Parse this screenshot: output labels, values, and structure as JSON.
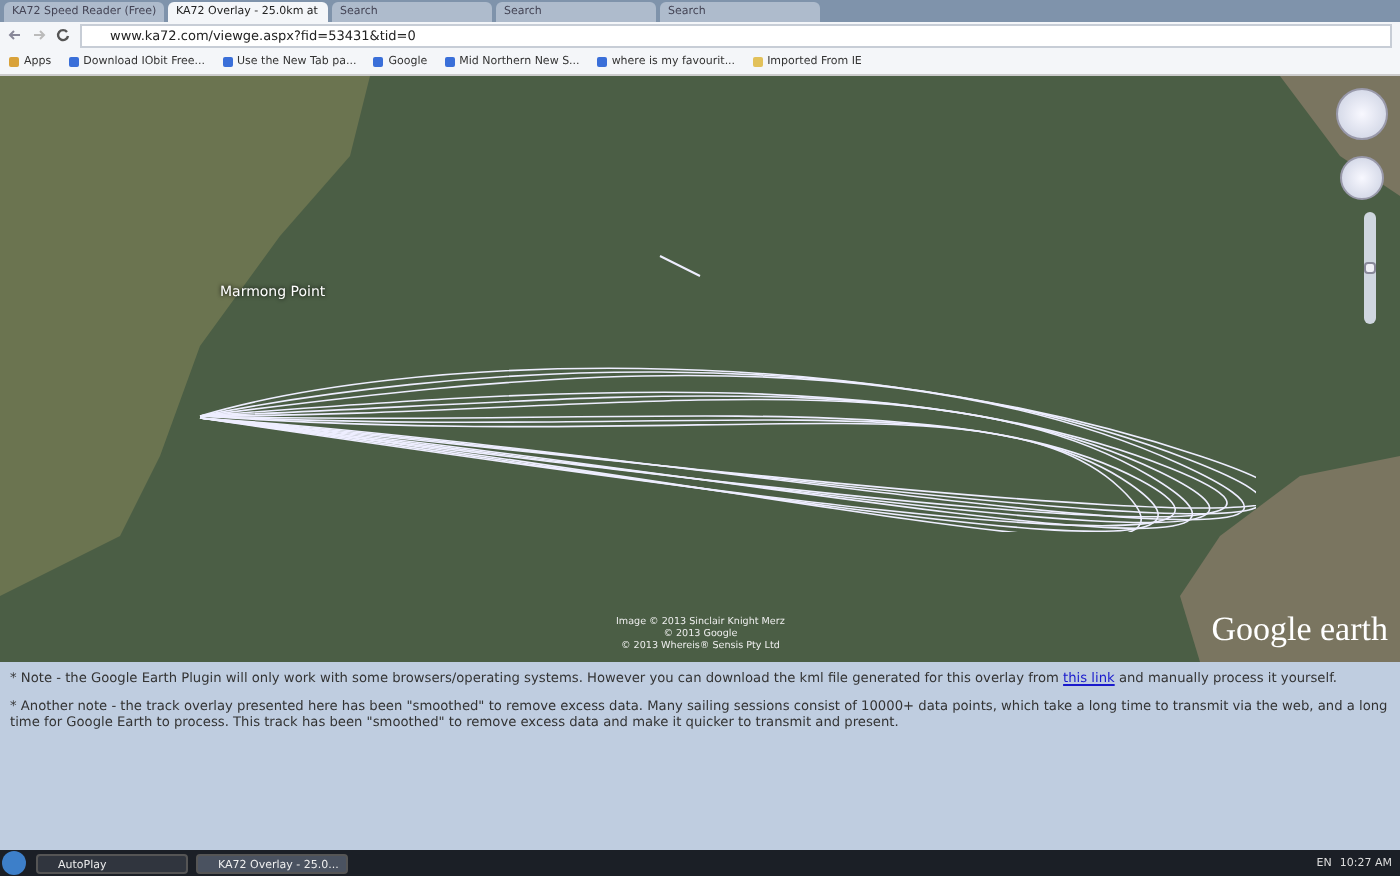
{
  "tabs": [
    {
      "label": "KA72 Speed Reader (Free)",
      "selected": false
    },
    {
      "label": "KA72 Overlay - 25.0km at",
      "selected": true
    },
    {
      "label": "Search",
      "selected": false
    },
    {
      "label": "Search",
      "selected": false
    },
    {
      "label": "Search",
      "selected": false
    }
  ],
  "address_bar": {
    "value": "www.ka72.com/viewge.aspx?fid=53431&tid=0"
  },
  "bookmarks": [
    {
      "label": "Apps",
      "kind": "apps"
    },
    {
      "label": "Download IObit Free...",
      "kind": "page"
    },
    {
      "label": "Use the New Tab pa...",
      "kind": "page"
    },
    {
      "label": "Google",
      "kind": "page"
    },
    {
      "label": "Mid Northern New S...",
      "kind": "page"
    },
    {
      "label": "where is my favourit...",
      "kind": "page"
    },
    {
      "label": "Imported From IE",
      "kind": "folder"
    }
  ],
  "map": {
    "place_label": "Marmong Point",
    "zoom_slider": {
      "level": 0.5
    },
    "copyright": [
      "Image © 2013 Sinclair Knight Merz",
      "© 2013 Google",
      "© 2013 Whereis® Sensis Pty Ltd"
    ],
    "logo": "Google earth"
  },
  "notes": [
    {
      "before": "* Note - the Google Earth Plugin will only work with some browsers/operating systems. However you can download the kml file generated for this overlay from ",
      "link": "this link",
      "after": " and manually process it yourself."
    },
    {
      "before": "* Another note - the track overlay presented here has been \"smoothed\" to remove excess data. Many sailing sessions consist of 10000+ data points, which take a long time to transmit via the web, and a long time for Google Earth to process. This track has been \"smoothed\" to remove excess data and make it quicker to transmit and present."
    }
  ],
  "taskbar": {
    "windows": [
      {
        "label": "AutoPlay",
        "selected": false
      },
      {
        "label": "KA72 Overlay - 25.0...",
        "selected": true
      }
    ],
    "language": "EN",
    "clock": "10:27 AM"
  }
}
